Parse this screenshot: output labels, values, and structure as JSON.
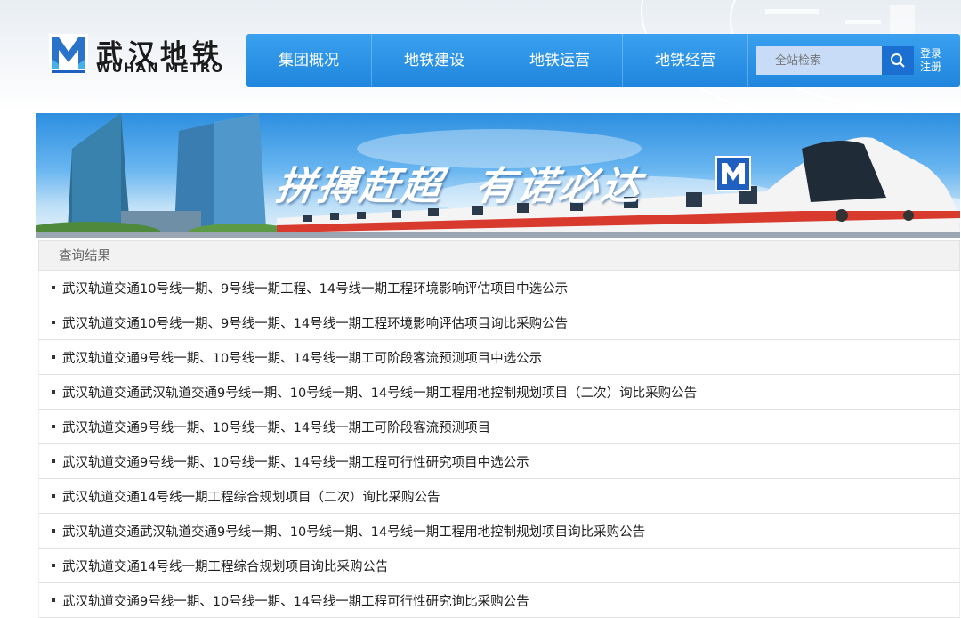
{
  "brand": {
    "name_cn": "武汉地铁",
    "name_en": "WUHAN METRO"
  },
  "nav": {
    "items": [
      {
        "label": "集团概况"
      },
      {
        "label": "地铁建设"
      },
      {
        "label": "地铁运营"
      },
      {
        "label": "地铁经营"
      }
    ],
    "search_placeholder": "全站检索",
    "search_icon": "search-icon",
    "login_label": "登录",
    "register_label": "注册"
  },
  "banner": {
    "slogan_part1": "拼搏赶超",
    "slogan_part2": "有诺必达"
  },
  "results": {
    "header": "查询结果",
    "items": [
      {
        "title": "武汉轨道交通10号线一期、9号线一期工程、14号线一期工程环境影响评估项目中选公示"
      },
      {
        "title": "武汉轨道交通10号线一期、9号线一期、14号线一期工程环境影响评估项目询比采购公告"
      },
      {
        "title": "武汉轨道交通9号线一期、10号线一期、14号线一期工可阶段客流预测项目中选公示"
      },
      {
        "title": "武汉轨道交通武汉轨道交通9号线一期、10号线一期、14号线一期工程用地控制规划项目（二次）询比采购公告"
      },
      {
        "title": "武汉轨道交通9号线一期、10号线一期、14号线一期工可阶段客流预测项目"
      },
      {
        "title": "武汉轨道交通9号线一期、10号线一期、14号线一期工程可行性研究项目中选公示"
      },
      {
        "title": "武汉轨道交通14号线一期工程综合规划项目（二次）询比采购公告"
      },
      {
        "title": "武汉轨道交通武汉轨道交通9号线一期、10号线一期、14号线一期工程用地控制规划项目询比采购公告"
      },
      {
        "title": "武汉轨道交通14号线一期工程综合规划项目询比采购公告"
      },
      {
        "title": "武汉轨道交通9号线一期、10号线一期、14号线一期工程可行性研究询比采购公告"
      }
    ]
  },
  "colors": {
    "nav_blue": "#2b93e6",
    "search_button": "#1a6fd0",
    "metro_logo_blue": "#1f5fbf"
  }
}
